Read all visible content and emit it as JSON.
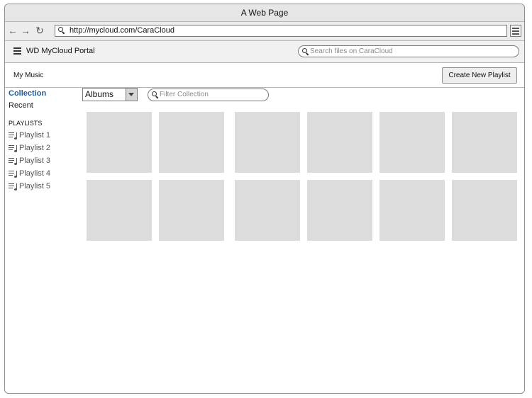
{
  "window": {
    "title": "A Web Page"
  },
  "browser": {
    "url": "http://mycloud.com/CaraCloud"
  },
  "header": {
    "title": "WD MyCloud Portal",
    "search_placeholder": "Search files on CaraCloud"
  },
  "subheader": {
    "title": "My Music",
    "create_button": "Create New Playlist"
  },
  "sidebar": {
    "collection": "Collection",
    "recent": "Recent",
    "playlists_heading": "PLAYLISTS",
    "playlists": [
      "Playlist 1",
      "Playlist 2",
      "Playlist 3",
      "Playlist 4",
      "Playlist 5"
    ]
  },
  "toolbar": {
    "view_select": "Albums",
    "filter_placeholder": "Filter Collection"
  },
  "colors": {
    "accent": "#1f5ea8",
    "tile": "#dcdcdc"
  }
}
